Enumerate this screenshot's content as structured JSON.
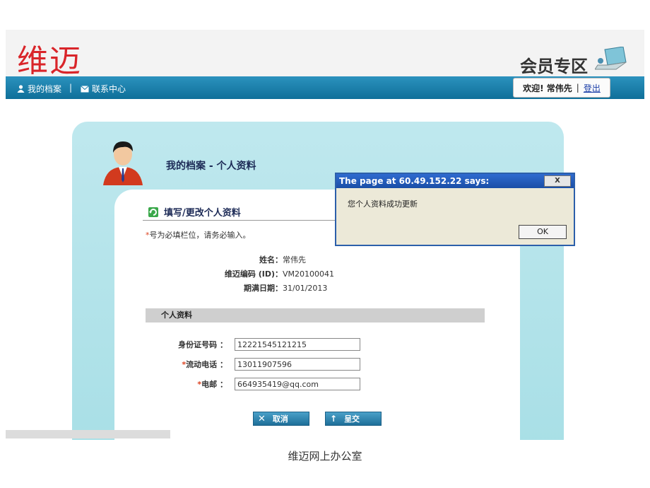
{
  "header": {
    "brand": "维迈",
    "zone_label": "会员专区"
  },
  "nav": {
    "items": [
      {
        "icon": "user-icon",
        "label": "我的档案"
      },
      {
        "icon": "mail-icon",
        "label": "联系中心"
      }
    ],
    "separator": "|",
    "welcome": "欢迎! 常伟先",
    "welcome_sep": "|",
    "logout": "登出"
  },
  "panel": {
    "title": "我的档案 - 个人资料",
    "section_title": "填写/更改个人资料",
    "note_star": "*",
    "note": "号为必填栏位，请务必输入。",
    "info": [
      {
        "label": "姓名：",
        "value": "常伟先"
      },
      {
        "label": "维迈编码 (ID)：",
        "value": "VM20100041"
      },
      {
        "label": "期满日期：",
        "value": "31/01/2013"
      }
    ],
    "subsection": "个人资料",
    "fields": [
      {
        "required": false,
        "label": "身份证号码 ：",
        "value": "12221545121215"
      },
      {
        "required": true,
        "label": "流动电话 ：",
        "value": "13011907596"
      },
      {
        "required": true,
        "label": "电邮 ：",
        "value": "664935419@qq.com"
      }
    ],
    "cancel_label": "取消",
    "submit_label": "呈交"
  },
  "dialog": {
    "title": "The page at 60.49.152.22 says:",
    "close": "X",
    "message": "您个人资料成功更新",
    "ok": "OK"
  },
  "caption": "维迈网上办公室",
  "colors": {
    "brand_red": "#d9252a",
    "nav_blue": "#1a7fac",
    "panel_cyan": "#b4e4ea"
  }
}
